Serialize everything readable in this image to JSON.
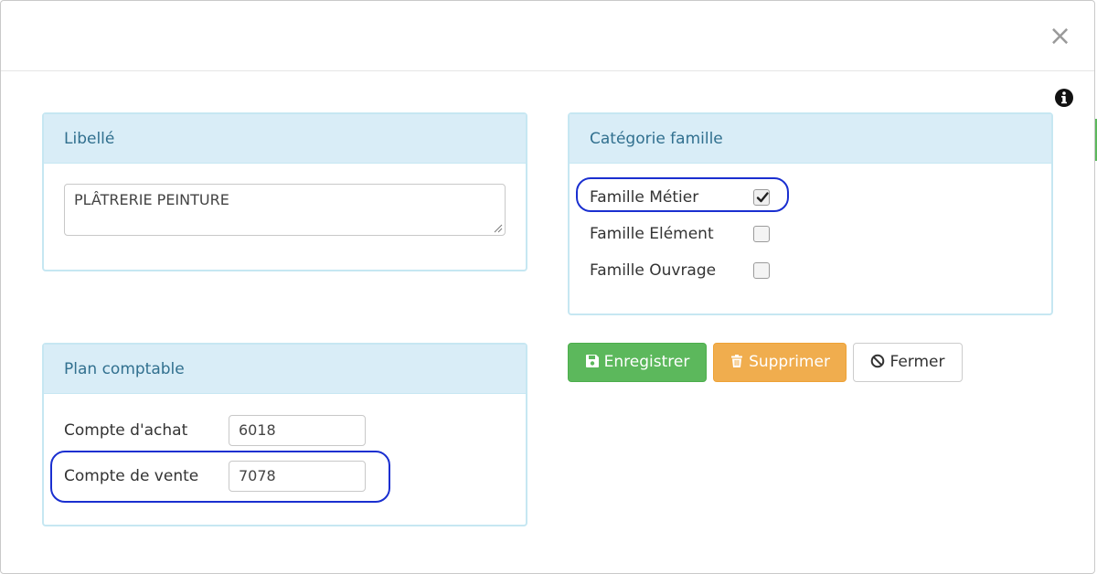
{
  "dialog": {
    "close_symbol": "×",
    "info_icon": "info-circle-icon"
  },
  "libelle_panel": {
    "heading": "Libellé",
    "value": "PLÂTRERIE PEINTURE"
  },
  "categorie_panel": {
    "heading": "Catégorie famille",
    "options": [
      {
        "label": "Famille Métier",
        "checked": true
      },
      {
        "label": "Famille Elément",
        "checked": false
      },
      {
        "label": "Famille Ouvrage",
        "checked": false
      }
    ]
  },
  "plan_panel": {
    "heading": "Plan comptable",
    "fields": [
      {
        "label": "Compte d'achat",
        "value": "6018"
      },
      {
        "label": "Compte de vente",
        "value": "7078"
      }
    ]
  },
  "actions": {
    "save_label": "Enregistrer",
    "delete_label": "Supprimer",
    "close_label": "Fermer"
  },
  "colors": {
    "panel_heading_bg": "#d9edf7",
    "panel_heading_text": "#31708f",
    "save_bg": "#5cb85c",
    "delete_bg": "#f0ad4e",
    "highlight": "#1a2fd0"
  }
}
